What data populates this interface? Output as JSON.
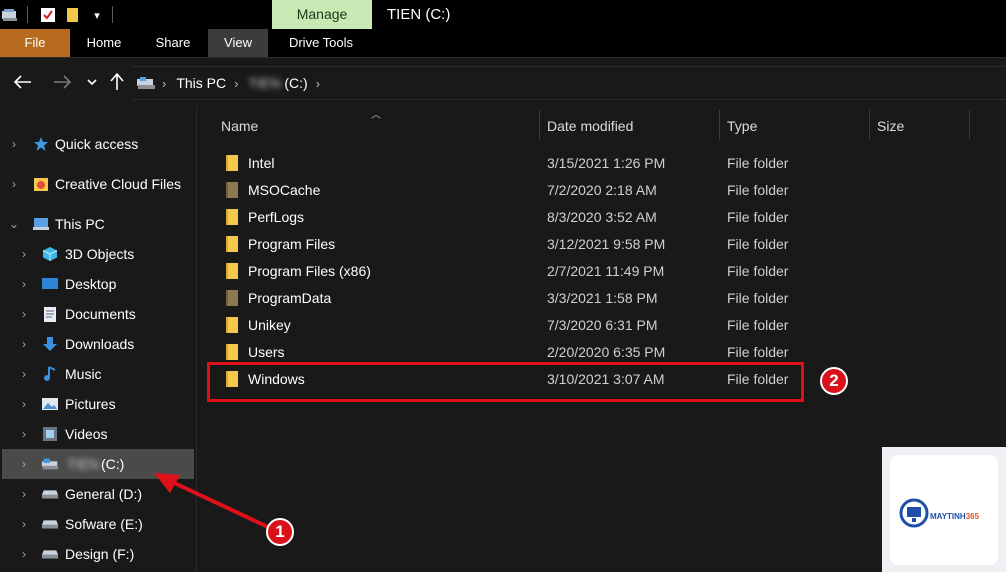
{
  "window": {
    "title": "TIEN (C:)",
    "context_tab": "Manage",
    "colors": {
      "file_tab": "#b76b1e",
      "manage_tab": "#c8e8b4",
      "highlight": "#e0101a",
      "folder": "#f4c84a",
      "folder_dim": "#8c7a4e"
    }
  },
  "ribbon": {
    "tabs": [
      {
        "label": "File"
      },
      {
        "label": "Home"
      },
      {
        "label": "Share"
      },
      {
        "label": "View"
      },
      {
        "label": "Drive Tools"
      }
    ]
  },
  "address": {
    "root": "This PC",
    "drive_name": "TIEN",
    "drive_letter": "(C:)"
  },
  "nav_pane": {
    "items": [
      {
        "label": "Quick access",
        "icon": "star-icon"
      },
      {
        "label": "Creative Cloud Files",
        "icon": "creative-cloud-icon"
      },
      {
        "label": "This PC",
        "icon": "computer-icon"
      },
      {
        "label": "3D Objects",
        "icon": "cube-icon"
      },
      {
        "label": "Desktop",
        "icon": "desktop-icon"
      },
      {
        "label": "Documents",
        "icon": "document-icon"
      },
      {
        "label": "Downloads",
        "icon": "download-icon"
      },
      {
        "label": "Music",
        "icon": "music-icon"
      },
      {
        "label": "Pictures",
        "icon": "picture-icon"
      },
      {
        "label": "Videos",
        "icon": "video-icon"
      },
      {
        "label_blur": "TIEN",
        "label": "(C:)",
        "icon": "windows-drive-icon"
      },
      {
        "label": "General (D:)",
        "icon": "drive-icon"
      },
      {
        "label": "Sofware (E:)",
        "icon": "drive-icon"
      },
      {
        "label": "Design (F:)",
        "icon": "drive-icon"
      }
    ]
  },
  "columns": {
    "name": "Name",
    "date": "Date modified",
    "type": "Type",
    "size": "Size"
  },
  "files": [
    {
      "name": "Intel",
      "date": "3/15/2021 1:26 PM",
      "type": "File folder"
    },
    {
      "name": "MSOCache",
      "date": "7/2/2020 2:18 AM",
      "type": "File folder"
    },
    {
      "name": "PerfLogs",
      "date": "8/3/2020 3:52 AM",
      "type": "File folder"
    },
    {
      "name": "Program Files",
      "date": "3/12/2021 9:58 PM",
      "type": "File folder"
    },
    {
      "name": "Program Files (x86)",
      "date": "2/7/2021 11:49 PM",
      "type": "File folder"
    },
    {
      "name": "ProgramData",
      "date": "3/3/2021 1:58 PM",
      "type": "File folder"
    },
    {
      "name": "Unikey",
      "date": "7/3/2020 6:31 PM",
      "type": "File folder"
    },
    {
      "name": "Users",
      "date": "2/20/2020 6:35 PM",
      "type": "File folder"
    },
    {
      "name": "Windows",
      "date": "3/10/2021 3:07 AM",
      "type": "File folder"
    }
  ],
  "annotations": {
    "step1": "1",
    "step2": "2"
  },
  "watermark": {
    "brand_main": "MAYTINH",
    "brand_num": "365"
  }
}
